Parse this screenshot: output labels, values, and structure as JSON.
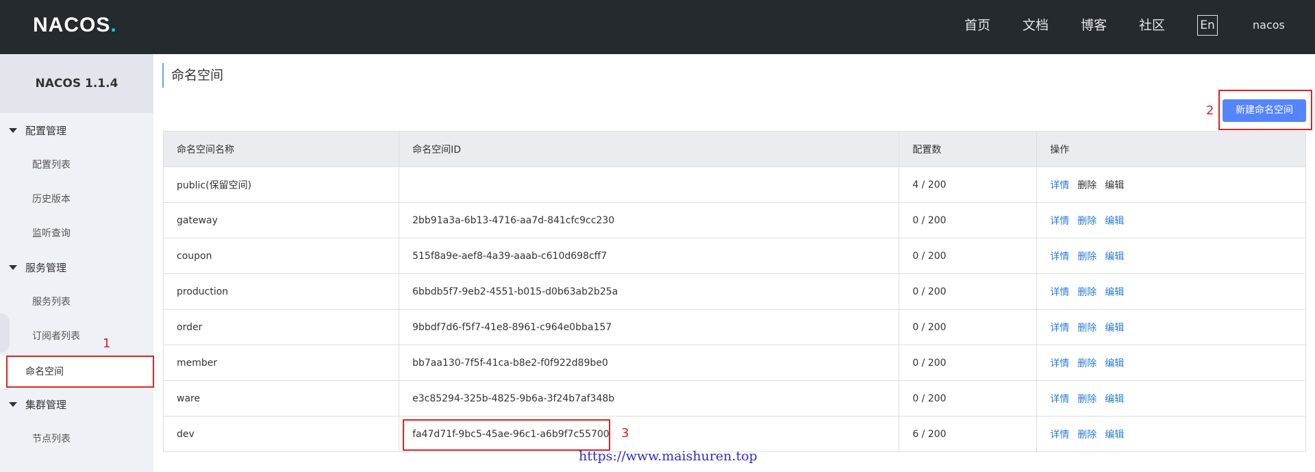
{
  "header": {
    "logo_text": "NACOS",
    "logo_dot": ".",
    "nav": [
      "首页",
      "文档",
      "博客",
      "社区"
    ],
    "lang_label": "En",
    "user": "nacos"
  },
  "sidebar": {
    "title": "NACOS 1.1.4",
    "groups": [
      {
        "label": "配置管理",
        "items": [
          "配置列表",
          "历史版本",
          "监听查询"
        ]
      },
      {
        "label": "服务管理",
        "items": [
          "服务列表",
          "订阅者列表"
        ]
      },
      {
        "label": "集群管理",
        "items": [
          "节点列表"
        ]
      }
    ],
    "active_item": "命名空间"
  },
  "main": {
    "title": "命名空间",
    "create_button": "新建命名空间",
    "table": {
      "headers": [
        "命名空间名称",
        "命名空间ID",
        "配置数",
        "操作"
      ],
      "rows": [
        {
          "name": "public(保留空间)",
          "id": "",
          "count": "4 / 200",
          "ops": [
            "详情",
            "删除",
            "编辑"
          ]
        },
        {
          "name": "gateway",
          "id": "2bb91a3a-6b13-4716-aa7d-841cfc9cc230",
          "count": "0 / 200",
          "ops": [
            "详情",
            "删除",
            "编辑"
          ]
        },
        {
          "name": "coupon",
          "id": "515f8a9e-aef8-4a39-aaab-c610d698cff7",
          "count": "0 / 200",
          "ops": [
            "详情",
            "删除",
            "编辑"
          ]
        },
        {
          "name": "production",
          "id": "6bbdb5f7-9eb2-4551-b015-d0b63ab2b25a",
          "count": "0 / 200",
          "ops": [
            "详情",
            "删除",
            "编辑"
          ]
        },
        {
          "name": "order",
          "id": "9bbdf7d6-f5f7-41e8-8961-c964e0bba157",
          "count": "0 / 200",
          "ops": [
            "详情",
            "删除",
            "编辑"
          ]
        },
        {
          "name": "member",
          "id": "bb7aa130-7f5f-41ca-b8e2-f0f922d89be0",
          "count": "0 / 200",
          "ops": [
            "详情",
            "删除",
            "编辑"
          ]
        },
        {
          "name": "ware",
          "id": "e3c85294-325b-4825-9b6a-3f24b7af348b",
          "count": "0 / 200",
          "ops": [
            "详情",
            "删除",
            "编辑"
          ]
        },
        {
          "name": "dev",
          "id": "fa47d71f-9bc5-45ae-96c1-a6b9f7c55700",
          "count": "6 / 200",
          "ops": [
            "详情",
            "删除",
            "编辑"
          ]
        }
      ]
    }
  },
  "annotations": {
    "mark_1": "1",
    "mark_2": "2",
    "mark_3": "3"
  },
  "watermark": "https://www.maishuren.top",
  "colors": {
    "header_bg": "#252a2f",
    "primary": "#5584ff",
    "link": "#2a7bd6",
    "highlight": "#e02020"
  }
}
